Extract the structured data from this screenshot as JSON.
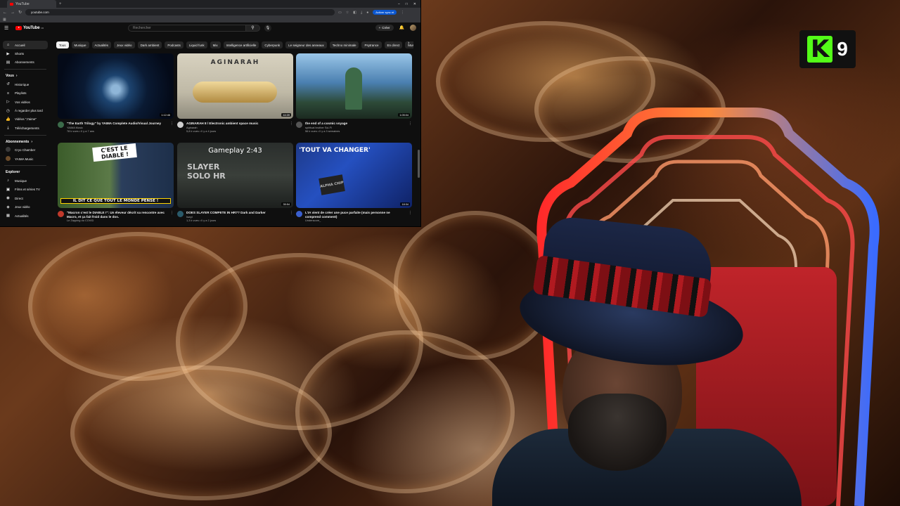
{
  "browser": {
    "tab_title": "YouTube",
    "url": "youtube.com",
    "upgrade_label": "Activer sync et"
  },
  "youtube": {
    "logo_text": "YouTube",
    "logo_region": "FR",
    "search_placeholder": "Rechercher",
    "create_label": "Créer"
  },
  "sidebar": {
    "main": [
      {
        "label": "Accueil",
        "icon": "home-icon",
        "active": true
      },
      {
        "label": "Shorts",
        "icon": "shorts-icon"
      },
      {
        "label": "Abonnements",
        "icon": "subscriptions-icon"
      }
    ],
    "you_header": "Vous",
    "you": [
      {
        "label": "Historique",
        "icon": "history-icon"
      },
      {
        "label": "Playlists",
        "icon": "playlist-icon"
      },
      {
        "label": "Vos vidéos",
        "icon": "your-videos-icon"
      },
      {
        "label": "À regarder plus tard",
        "icon": "watch-later-icon"
      },
      {
        "label": "Vidéos \"J'aime\"",
        "icon": "like-icon"
      },
      {
        "label": "Téléchargements",
        "icon": "download-icon"
      }
    ],
    "subs_header": "Abonnements",
    "subs": [
      {
        "label": "Cryo Chamber",
        "color": "#3a3a3a"
      },
      {
        "label": "YAIMA Music",
        "color": "#6b4b2a"
      }
    ],
    "explore_header": "Explorer",
    "explore": [
      {
        "label": "Musique",
        "icon": "music-icon"
      },
      {
        "label": "Films et séries TV",
        "icon": "movies-icon"
      },
      {
        "label": "Direct",
        "icon": "live-icon"
      },
      {
        "label": "Jeux vidéo",
        "icon": "gaming-icon"
      },
      {
        "label": "Actualités",
        "icon": "news-icon"
      }
    ]
  },
  "chips": [
    "Tous",
    "Musique",
    "Actualités",
    "Jeux vidéo",
    "Dark ambient",
    "Podcasts",
    "Liquid funk",
    "Mix",
    "Intelligence artificielle",
    "Cyberpunk",
    "Le seigneur des anneaux",
    "Techno minimale",
    "Psytrance",
    "En direct",
    "Musique"
  ],
  "videos": [
    {
      "title": "\"The Earth Trilogy\" by YAIMA Complete Audio/Visual Journey",
      "title2": "",
      "channel": "YAIMA Music",
      "stats": "78 k vues • Il y a 7 ans",
      "duration": "1:12:46",
      "theme": "earth",
      "av": "#3b6b4a"
    },
    {
      "title": "AGINARAH 8 / Electronic ambient space music",
      "title2": "",
      "channel": "Aginarah",
      "stats": "5,8 k vues • Il y a 4 jours",
      "duration": "44:39",
      "theme": "ship",
      "thumb_text": "AGINARAH",
      "av": "#cfcfcf"
    },
    {
      "title": "the end of a cosmic voyage",
      "title2": "",
      "channel": "spiritual brother Sci-Fi",
      "stats": "56 k vues • Il y a 3 semaines",
      "duration": "1:05:04",
      "theme": "alien",
      "av": "#555555"
    },
    {
      "title": "\"Macron c'est le DIABLE !\": Un éleveur décrit sa rencontre avec",
      "title2": "Macro, et ça fait froid dans le dos.",
      "channel": "Le Zapping du COVID",
      "stats": "",
      "duration": "",
      "theme": "macron",
      "thumb_text": "C'EST LE DIABLE !",
      "thumb_text2": "IL DIT CE QUE TOUT LE MONDE PENSE !",
      "av": "#c0392b"
    },
    {
      "title": "DOES SLAYER COMPETE IN HR?? Dark and Darker",
      "title2": "",
      "channel": "Iswyl",
      "stats": "1,3 k vues • Il y a 2 jours",
      "duration": "35:54",
      "theme": "slayer",
      "thumb_text": "Gameplay 2:43",
      "thumb_text2": "SLAYER SOLO HR",
      "av": "#2a5a6a"
    },
    {
      "title": "L'IA vient de créer une puce parfaite (mais personne ne",
      "title2": "comprend comment)",
      "channel": "Underscore_",
      "stats": "",
      "duration": "18:34",
      "theme": "chip",
      "thumb_text": "'TOUT VA CHANGER'",
      "thumb_text2": "ALPHA CHIP",
      "av": "#3a5fcf"
    }
  ],
  "overlay": {
    "logo_letter": "K",
    "logo_number": "9"
  }
}
